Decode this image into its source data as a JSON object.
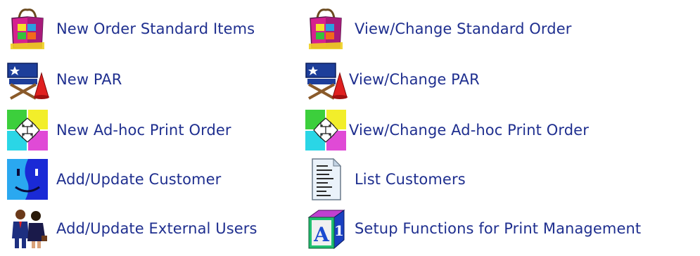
{
  "menu": {
    "left": [
      {
        "label": "New Order Standard Items",
        "icon": "shopping-bag-icon"
      },
      {
        "label": "New PAR",
        "icon": "director-chair-icon"
      },
      {
        "label": "New Ad-hoc Print Order",
        "icon": "arrows-grid-icon"
      },
      {
        "label": "Add/Update Customer",
        "icon": "finder-face-icon"
      },
      {
        "label": "Add/Update External Users",
        "icon": "users-icon"
      }
    ],
    "right": [
      {
        "label": "View/Change Standard Order",
        "icon": "shopping-bag-icon"
      },
      {
        "label": "View/Change PAR",
        "icon": "director-chair-icon"
      },
      {
        "label": "View/Change Ad-hoc Print Order",
        "icon": "arrows-grid-icon"
      },
      {
        "label": "List Customers",
        "icon": "document-list-icon"
      },
      {
        "label": "Setup Functions for Print Management",
        "icon": "abc-block-icon"
      }
    ]
  },
  "colors": {
    "link": "#1f2f8f",
    "background": "#ffffff"
  }
}
